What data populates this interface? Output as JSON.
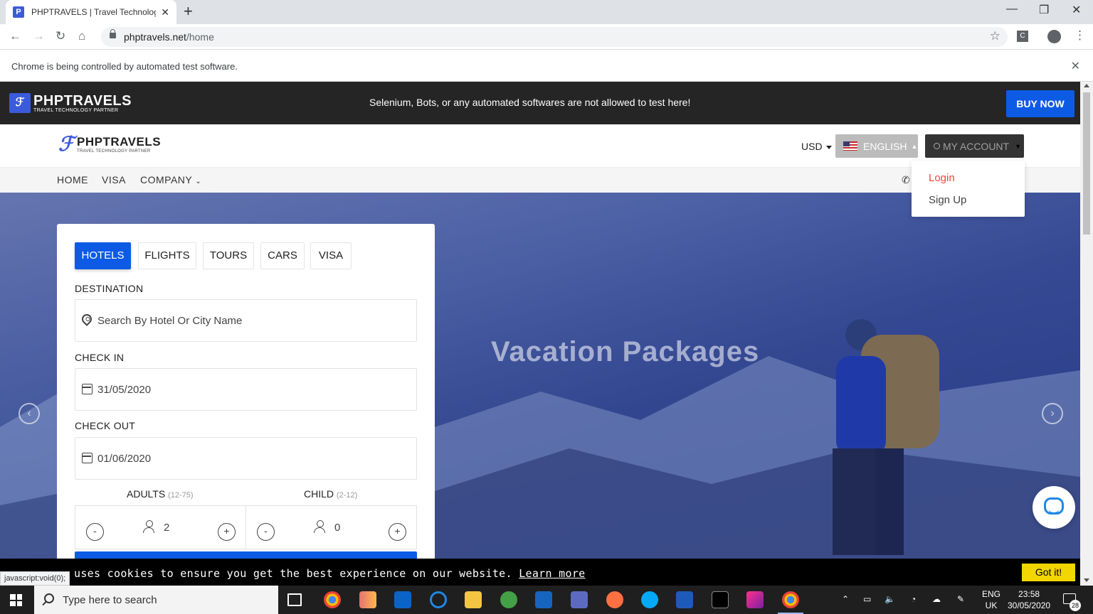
{
  "browser": {
    "tab_title": "PHPTRAVELS | Travel Technology",
    "tab_favicon": "P",
    "url_domain": "phptravels.net",
    "url_path": "/home",
    "ext_label": "C",
    "infobar_text": "Chrome is being controlled by automated test software."
  },
  "topbar": {
    "brand": "PHPTRAVELS",
    "tagline": "TRAVEL TECHNOLOGY PARTNER",
    "message": "Selenium, Bots, or any automated softwares are not allowed to test here!",
    "buy_now": "BUY NOW"
  },
  "header": {
    "brand": "PHPTRAVELS",
    "tagline": "TRAVEL TECHNOLOGY PARTNER",
    "currency": "USD",
    "language": "ENGLISH",
    "account": "MY ACCOUNT",
    "account_menu": {
      "login": "Login",
      "signup": "Sign Up"
    }
  },
  "nav": {
    "items": [
      "HOME",
      "VISA",
      "COMPANY"
    ]
  },
  "hero": {
    "title": "Vacation Packages"
  },
  "search": {
    "tabs": [
      "HOTELS",
      "FLIGHTS",
      "TOURS",
      "CARS",
      "VISA"
    ],
    "active_tab": "HOTELS",
    "destination_label": "DESTINATION",
    "destination_placeholder": "Search By Hotel Or City Name",
    "checkin_label": "CHECK IN",
    "checkin_value": "31/05/2020",
    "checkout_label": "CHECK OUT",
    "checkout_value": "01/06/2020",
    "adults_label": "ADULTS",
    "adults_range": "(12-75)",
    "adults_value": "2",
    "child_label": "CHILD",
    "child_range": "(2-12)",
    "child_value": "0",
    "minus": "-",
    "plus": "+"
  },
  "cookie": {
    "text": "uses cookies to ensure you get the best experience on our website.",
    "learn_more": "Learn more",
    "button": "Got it!"
  },
  "status_url": "javascript:void(0);",
  "taskbar": {
    "search_placeholder": "Type here to search",
    "lang_1": "ENG",
    "lang_2": "UK",
    "time": "23:58",
    "date": "30/05/2020",
    "notifications": "28"
  },
  "colors": {
    "accent": "#0d5be5",
    "login_red": "#f44336",
    "cookie_yellow": "#f1d600"
  }
}
